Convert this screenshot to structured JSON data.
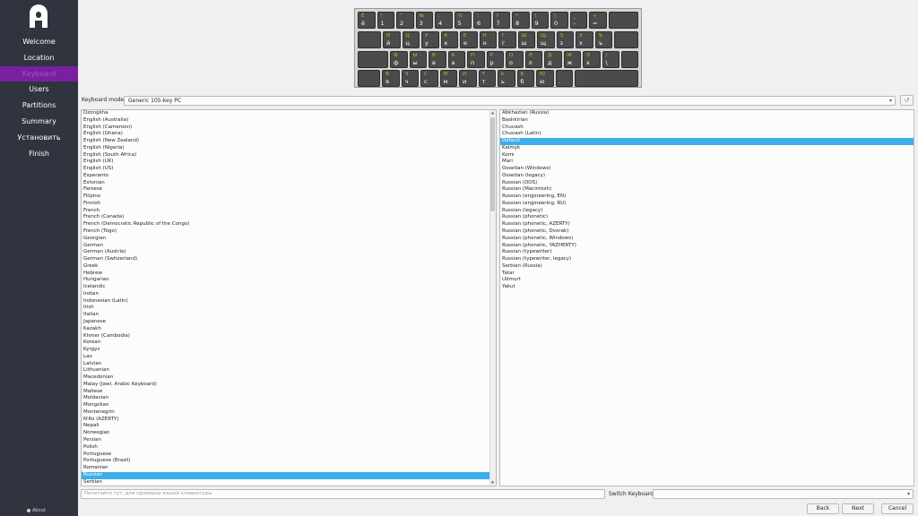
{
  "sidebar": {
    "items": [
      {
        "label": "Welcome"
      },
      {
        "label": "Location"
      },
      {
        "label": "Keyboard"
      },
      {
        "label": "Users"
      },
      {
        "label": "Partitions"
      },
      {
        "label": "Summary"
      },
      {
        "label": "Установить"
      },
      {
        "label": "Finish"
      }
    ],
    "active_index": 2,
    "about_label": "About"
  },
  "keyboard_preview": {
    "rows": [
      [
        [
          "Ё",
          "ё"
        ],
        [
          "!",
          "1"
        ],
        [
          "\"",
          "2"
        ],
        [
          "№",
          "3"
        ],
        [
          ";",
          "4"
        ],
        [
          "%",
          "5"
        ],
        [
          ":",
          "6"
        ],
        [
          "?",
          "7"
        ],
        [
          "*",
          "8"
        ],
        [
          "(",
          "9"
        ],
        [
          ")",
          "0"
        ],
        [
          "_",
          "-"
        ],
        [
          "+",
          "="
        ]
      ],
      [
        [
          "Й",
          "й"
        ],
        [
          "Ц",
          "ц"
        ],
        [
          "У",
          "у"
        ],
        [
          "К",
          "к"
        ],
        [
          "Е",
          "е"
        ],
        [
          "Н",
          "н"
        ],
        [
          "Г",
          "г"
        ],
        [
          "Ш",
          "ш"
        ],
        [
          "Щ",
          "щ"
        ],
        [
          "З",
          "з"
        ],
        [
          "Х",
          "х"
        ],
        [
          "Ъ",
          "ъ"
        ]
      ],
      [
        [
          "Ф",
          "ф"
        ],
        [
          "Ы",
          "ы"
        ],
        [
          "В",
          "в"
        ],
        [
          "А",
          "а"
        ],
        [
          "П",
          "п"
        ],
        [
          "Р",
          "р"
        ],
        [
          "О",
          "о"
        ],
        [
          "Л",
          "л"
        ],
        [
          "Д",
          "д"
        ],
        [
          "Ж",
          "ж"
        ],
        [
          "Э",
          "э"
        ],
        [
          "/",
          "\\"
        ]
      ],
      [
        [
          "Я",
          "я"
        ],
        [
          "Ч",
          "ч"
        ],
        [
          "С",
          "с"
        ],
        [
          "М",
          "м"
        ],
        [
          "И",
          "и"
        ],
        [
          "Т",
          "т"
        ],
        [
          "Ь",
          "ь"
        ],
        [
          "Б",
          "б"
        ],
        [
          "Ю",
          "ю"
        ],
        [
          ",",
          "."
        ]
      ]
    ]
  },
  "model": {
    "label": "Keyboard model:",
    "value": "Generic 105-key PC",
    "reset_icon": "undo-icon"
  },
  "layouts": {
    "items": [
      "Dzongkha",
      "English (Australia)",
      "English (Cameroon)",
      "English (Ghana)",
      "English (New Zealand)",
      "English (Nigeria)",
      "English (South Africa)",
      "English (UK)",
      "English (US)",
      "Esperanto",
      "Estonian",
      "Faroese",
      "Filipino",
      "Finnish",
      "French",
      "French (Canada)",
      "French (Democratic Republic of the Congo)",
      "French (Togo)",
      "Georgian",
      "German",
      "German (Austria)",
      "German (Switzerland)",
      "Greek",
      "Hebrew",
      "Hungarian",
      "Icelandic",
      "Indian",
      "Indonesian (Latin)",
      "Irish",
      "Italian",
      "Japanese",
      "Kazakh",
      "Khmer (Cambodia)",
      "Korean",
      "Kyrgyz",
      "Lao",
      "Latvian",
      "Lithuanian",
      "Macedonian",
      "Malay (Jawi, Arabic Keyboard)",
      "Maltese",
      "Moldavian",
      "Mongolian",
      "Montenegrin",
      "N'Ko (AZERTY)",
      "Nepali",
      "Norwegian",
      "Persian",
      "Polish",
      "Portuguese",
      "Portuguese (Brazil)",
      "Romanian",
      "Russian",
      "Serbian"
    ],
    "selected": "Russian"
  },
  "variants": {
    "items": [
      "Abkhazian (Russia)",
      "Bashkirian",
      "Chuvash",
      "Chuvash (Latin)",
      "Default",
      "Kalmyk",
      "Komi",
      "Mari",
      "Ossetian (Windows)",
      "Ossetian (legacy)",
      "Russian (DOS)",
      "Russian (Macintosh)",
      "Russian (engineering, EN)",
      "Russian (engineering, RU)",
      "Russian (legacy)",
      "Russian (phonetic)",
      "Russian (phonetic, AZERTY)",
      "Russian (phonetic, Dvorak)",
      "Russian (phonetic, Windows)",
      "Russian (phonetic, YAZHERTY)",
      "Russian (typewriter)",
      "Russian (typewriter, legacy)",
      "Serbian (Russia)",
      "Tatar",
      "Udmurt",
      "Yakut"
    ],
    "selected": "Default"
  },
  "test": {
    "placeholder": "Печатайте тут, для проверки вашей клавиатуры"
  },
  "switch": {
    "label": "Switch Keyboard:",
    "value": ""
  },
  "buttons": {
    "back": "Back",
    "next": "Next",
    "cancel": "Cancel"
  },
  "colors": {
    "sidebar_bg": "#2f343f",
    "active_bg": "#7a1fa2",
    "selection": "#3daee9",
    "key_upper": "#8bd21b"
  }
}
